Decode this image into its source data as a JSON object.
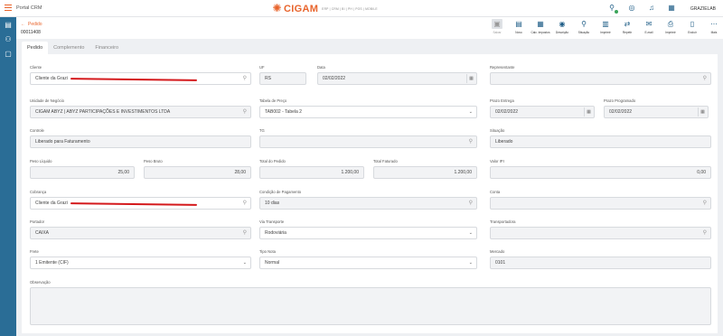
{
  "app": {
    "title": "Portal CRM",
    "user": "GRAZIELAB"
  },
  "brand": {
    "name": "CIGAM",
    "tagline": "ERP | CRM | BI | PH | POS | MOBILE",
    "accent": "#e8642c",
    "sidebar_color": "#2a6d96"
  },
  "header": {
    "breadcrumb": "Pedido",
    "doc_number": "00011408"
  },
  "toolbar": [
    {
      "label": "Salvar",
      "icon": "save-icon",
      "disabled": true
    },
    {
      "label": "Novo",
      "icon": "document-icon"
    },
    {
      "label": "Calc. Impostos",
      "icon": "calculator-icon"
    },
    {
      "label": "Descrição",
      "icon": "description-icon"
    },
    {
      "label": "Situação",
      "icon": "situation-icon"
    },
    {
      "label": "Imprimir",
      "icon": "print-icon"
    },
    {
      "label": "Repetir",
      "icon": "repeat-icon"
    },
    {
      "label": "E-mail",
      "icon": "mail-icon"
    },
    {
      "label": "Imprimir",
      "icon": "printer-icon"
    },
    {
      "label": "Excluir",
      "icon": "trash-icon"
    },
    {
      "label": "Mais",
      "icon": "more-icon"
    }
  ],
  "tabs": [
    "Pedido",
    "Complemento",
    "Financeiro"
  ],
  "form": {
    "cliente": {
      "label": "Cliente",
      "value": "Cliente da Grazi"
    },
    "uf": {
      "label": "UF",
      "value": "RS"
    },
    "data": {
      "label": "Data",
      "value": "02/02/2022"
    },
    "representante": {
      "label": "Representante",
      "value": ""
    },
    "unidade": {
      "label": "Unidade de Negócio",
      "value": "CIGAM ABYZ | ABYZ PARTICIPAÇÕES E INVESTIMENTOS LTDA"
    },
    "tabela_preco": {
      "label": "Tabela de Preço",
      "value": "TAB002 - Tabela 2"
    },
    "prazo_entrega": {
      "label": "Prazo Entrega",
      "value": "02/02/2022"
    },
    "prazo_programado": {
      "label": "Prazo Programado",
      "value": "02/02/2022"
    },
    "controle": {
      "label": "Controle",
      "value": "Liberado para Faturamento"
    },
    "tg": {
      "label": "TG",
      "value": ""
    },
    "situacao": {
      "label": "Situação",
      "value": "Liberado"
    },
    "peso_liquido": {
      "label": "Peso Líquido",
      "value": "25,00"
    },
    "peso_bruto": {
      "label": "Peso Bruto",
      "value": "28,00"
    },
    "total_pedido": {
      "label": "Total do Pedido",
      "value": "1.200,00"
    },
    "total_faturado": {
      "label": "Total Faturado",
      "value": "1.200,00"
    },
    "valor_ipi": {
      "label": "Valor IPI",
      "value": "0,00"
    },
    "cobranca": {
      "label": "Cobrança",
      "value": "Cliente da Grazi"
    },
    "condicao_pagamento": {
      "label": "Condição de Pagamento",
      "value": "10 dias"
    },
    "conta": {
      "label": "Conta",
      "value": ""
    },
    "portador": {
      "label": "Portador",
      "value": "CAIXA"
    },
    "via_transporte": {
      "label": "Via Transporte",
      "value": "Rodoviária"
    },
    "transportadora": {
      "label": "Transportadora",
      "value": ""
    },
    "frete": {
      "label": "Frete",
      "value": "1 Emitente (CIF)"
    },
    "tipo_nota": {
      "label": "Tipo Nota",
      "value": "Normal"
    },
    "mercado": {
      "label": "Mercado",
      "value": "0101"
    },
    "observacao": {
      "label": "Observação",
      "value": ""
    }
  }
}
